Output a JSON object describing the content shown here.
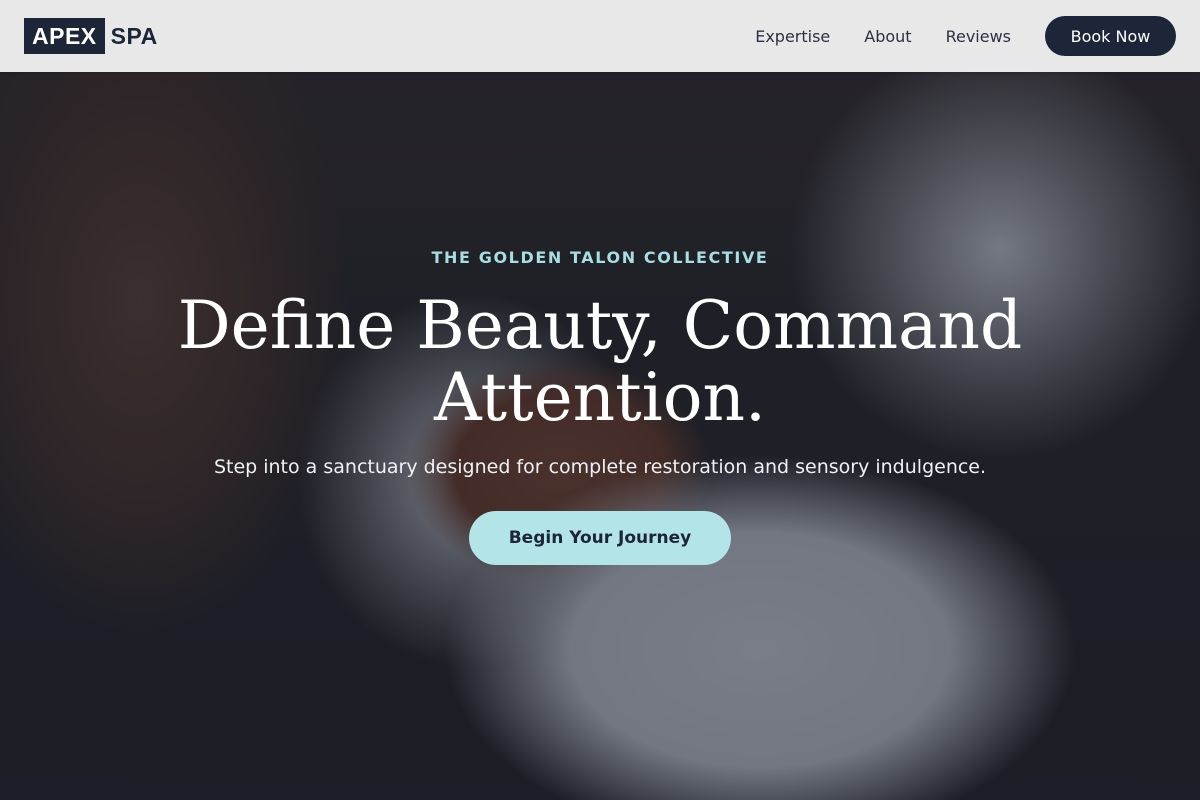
{
  "header": {
    "logo": {
      "boxed_text": "APEX",
      "text": "SPA"
    },
    "nav": [
      {
        "label": "Expertise"
      },
      {
        "label": "About"
      },
      {
        "label": "Reviews"
      }
    ],
    "book_button": "Book Now"
  },
  "hero": {
    "eyebrow": "THE GOLDEN TALON COLLECTIVE",
    "headline": "Define Beauty, Command Attention.",
    "subheadline": "Step into a sanctuary designed for complete restoration and sensory indulgence.",
    "cta_button": "Begin Your Journey",
    "background_image": "facial-treatment-photo"
  },
  "colors": {
    "brand_navy": "#1d2638",
    "accent_aqua": "#b2e4e8",
    "eyebrow_aqua": "#a8dde3",
    "header_bg": "#f4f4f5"
  }
}
